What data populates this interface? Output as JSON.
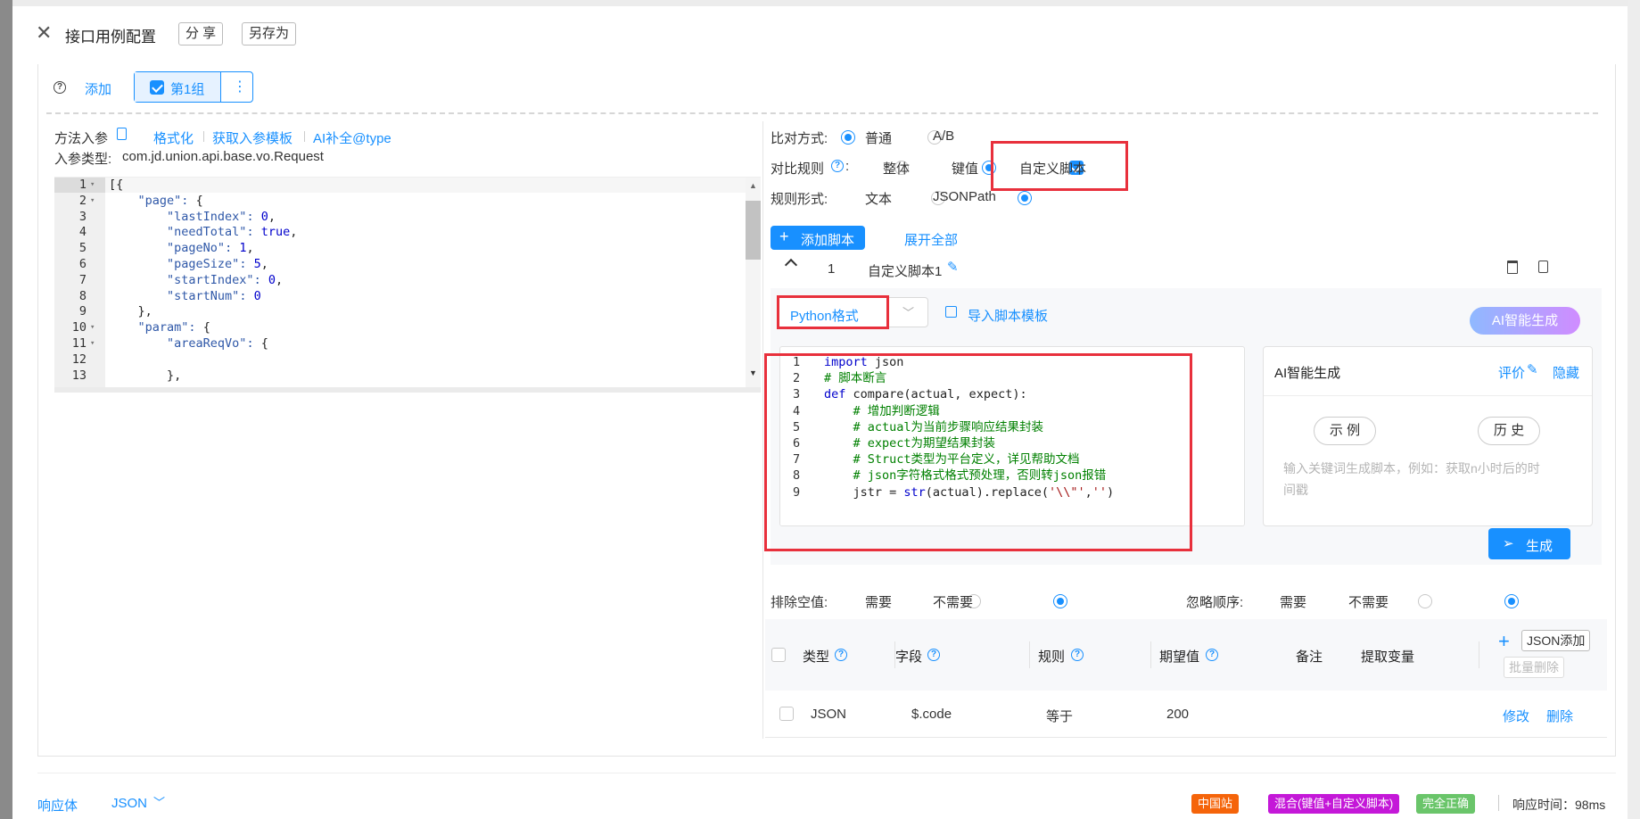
{
  "header": {
    "title": "接口用例配置",
    "share": "分 享",
    "save_as": "另存为"
  },
  "groups": {
    "add": "添加",
    "group1": "第1组",
    "more": "⋮"
  },
  "left": {
    "method_param": "方法入参",
    "format": "格式化",
    "get_template": "获取入参模板",
    "ai_complete": "AI补全@type",
    "param_type_label": "入参类型:",
    "param_type_value": "com.jd.union.api.base.vo.Request"
  },
  "json_lines": [
    {
      "n": "1",
      "t": "[{"
    },
    {
      "n": "2",
      "t": "    \"page\": {"
    },
    {
      "n": "3",
      "t": "        \"lastIndex\": 0,"
    },
    {
      "n": "4",
      "t": "        \"needTotal\": true,"
    },
    {
      "n": "5",
      "t": "        \"pageNo\": 1,"
    },
    {
      "n": "6",
      "t": "        \"pageSize\": 5,"
    },
    {
      "n": "7",
      "t": "        \"startIndex\": 0,"
    },
    {
      "n": "8",
      "t": "        \"startNum\": 0"
    },
    {
      "n": "9",
      "t": "    },"
    },
    {
      "n": "10",
      "t": "    \"param\": {"
    },
    {
      "n": "11",
      "t": "        \"areaReqVo\": {"
    },
    {
      "n": "12",
      "t": ""
    },
    {
      "n": "13",
      "t": "        },"
    }
  ],
  "right": {
    "compare_mode_label": "比对方式:",
    "mode_normal": "普通",
    "mode_ab": "A/B",
    "compare_rule_label": "对比规则",
    "rule_whole": "整体",
    "rule_keyvalue": "键值",
    "rule_custom": "自定义脚本",
    "rule_form_label": "规则形式:",
    "form_text": "文本",
    "form_jsonpath": "JSONPath",
    "add_script": "添加脚本",
    "expand_all": "展开全部",
    "script_index": "1",
    "script_name": "自定义脚本1",
    "format_select": "Python格式",
    "import_template": "导入脚本模板",
    "ai_generate_btn": "AI智能生成",
    "ai_panel_title": "AI智能生成",
    "ai_rate": "评价",
    "ai_hide": "隐藏",
    "ai_example": "示 例",
    "ai_history": "历 史",
    "ai_placeholder": "输入关键词生成脚本，例如：获取n小时后的时间戳",
    "ai_generate": "生成"
  },
  "script_lines": [
    {
      "n": "1",
      "t": "import json"
    },
    {
      "n": "2",
      "t": "# 脚本断言"
    },
    {
      "n": "3",
      "t": "def compare(actual, expect):"
    },
    {
      "n": "4",
      "t": "    # 增加判断逻辑"
    },
    {
      "n": "5",
      "t": "    # actual为当前步骤响应结果封装"
    },
    {
      "n": "6",
      "t": "    # expect为期望结果封装"
    },
    {
      "n": "7",
      "t": "    # Struct类型为平台定义，详见帮助文档"
    },
    {
      "n": "8",
      "t": "    # json字符格式格式预处理，否则转json报错"
    },
    {
      "n": "9",
      "t": "    jstr = str(actual).replace('\\\\\"','')"
    }
  ],
  "options": {
    "exclude_empty": "排除空值:",
    "need": "需要",
    "no_need": "不需要",
    "ignore_order": "忽略顺序:"
  },
  "table": {
    "headers": [
      "类型",
      "字段",
      "规则",
      "期望值",
      "备注",
      "提取变量"
    ],
    "json_add": "JSON添加",
    "batch_delete": "批量删除",
    "add_icon": "+",
    "rows": [
      {
        "type": "JSON",
        "field": "$.code",
        "rule": "等于",
        "expect": "200",
        "edit": "修改",
        "delete": "删除"
      }
    ]
  },
  "footer": {
    "response_body": "响应体",
    "json_select": "JSON",
    "tag_site": "中国站",
    "tag_mix": "混合(键值+自定义脚本)",
    "tag_correct": "完全正确",
    "resp_time": "响应时间：98ms"
  },
  "colors": {
    "accent": "#1890ff",
    "highlight": "#e8303c",
    "tag_site": "#f5640a",
    "tag_mix": "#c418d8",
    "tag_correct": "#6ac56a"
  }
}
